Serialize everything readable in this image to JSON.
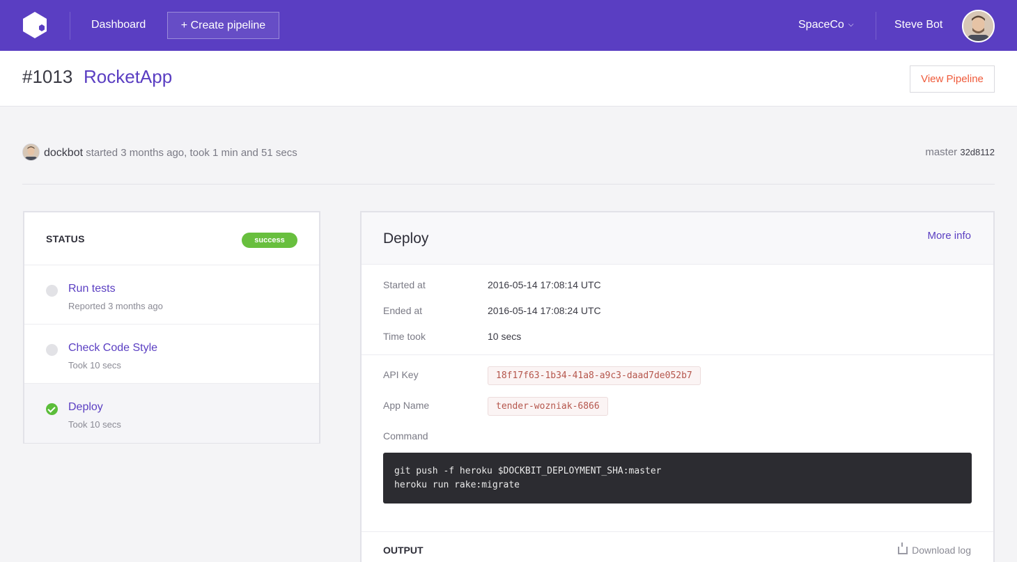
{
  "nav": {
    "dashboard": "Dashboard",
    "create_pipeline": "+ Create pipeline",
    "org": "SpaceCo",
    "user": "Steve Bot"
  },
  "header": {
    "build_number": "#1013",
    "app_name": "RocketApp",
    "view_pipeline": "View Pipeline"
  },
  "build_info": {
    "user": "dockbot",
    "summary": "started 3 months ago, took 1 min and 51 secs",
    "branch": "master",
    "sha": "32d8112"
  },
  "status": {
    "title": "STATUS",
    "badge": "success",
    "steps": [
      {
        "name": "Run tests",
        "sub": "Reported 3 months ago",
        "state": "pending"
      },
      {
        "name": "Check Code Style",
        "sub": "Took 10 secs",
        "state": "pending"
      },
      {
        "name": "Deploy",
        "sub": "Took 10 secs",
        "state": "success"
      }
    ]
  },
  "deploy": {
    "title": "Deploy",
    "more_info": "More info",
    "started_label": "Started at",
    "started_value": "2016-05-14 17:08:14 UTC",
    "ended_label": "Ended at",
    "ended_value": "2016-05-14 17:08:24 UTC",
    "took_label": "Time took",
    "took_value": "10 secs",
    "api_key_label": "API Key",
    "api_key_value": "18f17f63-1b34-41a8-a9c3-daad7de052b7",
    "app_name_label": "App Name",
    "app_name_value": "tender-wozniak-6866",
    "command_label": "Command",
    "command_value": "git push -f heroku $DOCKBIT_DEPLOYMENT_SHA:master\nheroku run rake:migrate",
    "output_title": "OUTPUT",
    "download_log": "Download log"
  },
  "colors": {
    "brand": "#5a3ec2",
    "success": "#68bf3e",
    "accent": "#ef5a3a"
  }
}
